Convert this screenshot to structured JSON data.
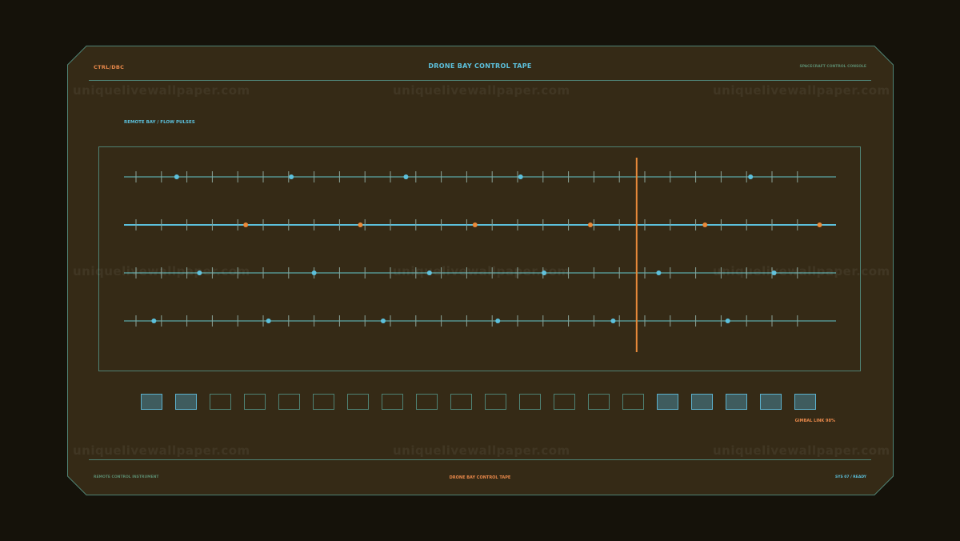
{
  "header": {
    "left_label": "CTRL/DBC",
    "title": "DRONE BAY CONTROL TAPE",
    "right_label": "SPACECRAFT CONTROL CONSOLE"
  },
  "section_label": "REMOTE BAY / FLOW PULSES",
  "tape": {
    "cursor_color": "#e8893a",
    "accent_color": "#5cc0dc",
    "lanes": [
      {
        "color": "#5cc0dc",
        "highlight": false,
        "markers": [
          0.074,
          0.235,
          0.396,
          0.557,
          0.88
        ]
      },
      {
        "color": "#e8893a",
        "highlight": true,
        "markers": [
          0.171,
          0.332,
          0.493,
          0.655,
          0.816,
          0.977
        ]
      },
      {
        "color": "#5cc0dc",
        "highlight": false,
        "markers": [
          0.106,
          0.267,
          0.429,
          0.59,
          0.751,
          0.913
        ]
      },
      {
        "color": "#5cc0dc",
        "highlight": false,
        "markers": [
          0.042,
          0.203,
          0.364,
          0.525,
          0.687,
          0.848
        ]
      }
    ],
    "cursor_position": 0.72
  },
  "cells": {
    "states": [
      true,
      true,
      false,
      false,
      false,
      false,
      false,
      false,
      false,
      false,
      false,
      false,
      false,
      false,
      false,
      true,
      true,
      true,
      true,
      true
    ]
  },
  "gimbal_label": "GIMBAL LINK 98%",
  "footer": {
    "left": "REMOTE CONTROL INSTRUMENT",
    "center": "DRONE BAY CONTROL TAPE",
    "right": "SYS 07 / READY"
  },
  "watermark": "uniquelivewallpaper.com"
}
